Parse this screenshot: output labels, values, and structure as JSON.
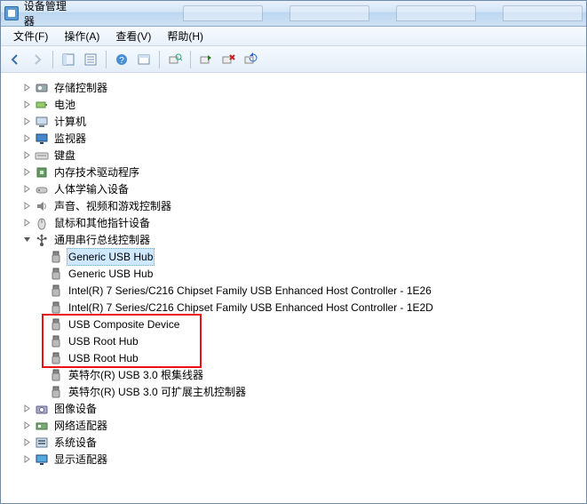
{
  "window": {
    "title": "设备管理器"
  },
  "menu": {
    "file": "文件(F)",
    "action": "操作(A)",
    "view": "查看(V)",
    "help": "帮助(H)"
  },
  "categories": [
    {
      "key": "storage",
      "label": "存储控制器",
      "icon": "storage"
    },
    {
      "key": "battery",
      "label": "电池",
      "icon": "battery"
    },
    {
      "key": "computer",
      "label": "计算机",
      "icon": "computer"
    },
    {
      "key": "monitor",
      "label": "监视器",
      "icon": "monitor"
    },
    {
      "key": "keyboard",
      "label": "键盘",
      "icon": "keyboard"
    },
    {
      "key": "memtech",
      "label": "内存技术驱动程序",
      "icon": "chip"
    },
    {
      "key": "hid",
      "label": "人体学输入设备",
      "icon": "hid"
    },
    {
      "key": "sound",
      "label": "声音、视频和游戏控制器",
      "icon": "sound"
    },
    {
      "key": "mouse",
      "label": "鼠标和其他指针设备",
      "icon": "mouse"
    },
    {
      "key": "usb",
      "label": "通用串行总线控制器",
      "icon": "usb",
      "expanded": true
    },
    {
      "key": "imaging",
      "label": "图像设备",
      "icon": "camera"
    },
    {
      "key": "network",
      "label": "网络适配器",
      "icon": "nic"
    },
    {
      "key": "system",
      "label": "系统设备",
      "icon": "system"
    },
    {
      "key": "display",
      "label": "显示适配器",
      "icon": "display"
    }
  ],
  "usb_devices": [
    {
      "label": "Generic USB Hub",
      "selected": true
    },
    {
      "label": "Generic USB Hub"
    },
    {
      "label": "Intel(R) 7 Series/C216 Chipset Family USB Enhanced Host Controller - 1E26"
    },
    {
      "label": "Intel(R) 7 Series/C216 Chipset Family USB Enhanced Host Controller - 1E2D"
    },
    {
      "label": "USB Composite Device",
      "highlight": true
    },
    {
      "label": "USB Root Hub",
      "highlight": true
    },
    {
      "label": "USB Root Hub",
      "highlight": true
    },
    {
      "label": "英特尔(R) USB 3.0 根集线器"
    },
    {
      "label": "英特尔(R) USB 3.0 可扩展主机控制器"
    }
  ],
  "icons": {
    "storage": "storage-controller-icon",
    "battery": "battery-icon",
    "computer": "computer-icon",
    "monitor": "monitor-icon",
    "keyboard": "keyboard-icon",
    "chip": "chip-icon",
    "hid": "hid-icon",
    "sound": "sound-icon",
    "mouse": "mouse-icon",
    "usb": "usb-icon",
    "camera": "camera-icon",
    "nic": "network-adapter-icon",
    "system": "system-device-icon",
    "display": "display-adapter-icon"
  }
}
